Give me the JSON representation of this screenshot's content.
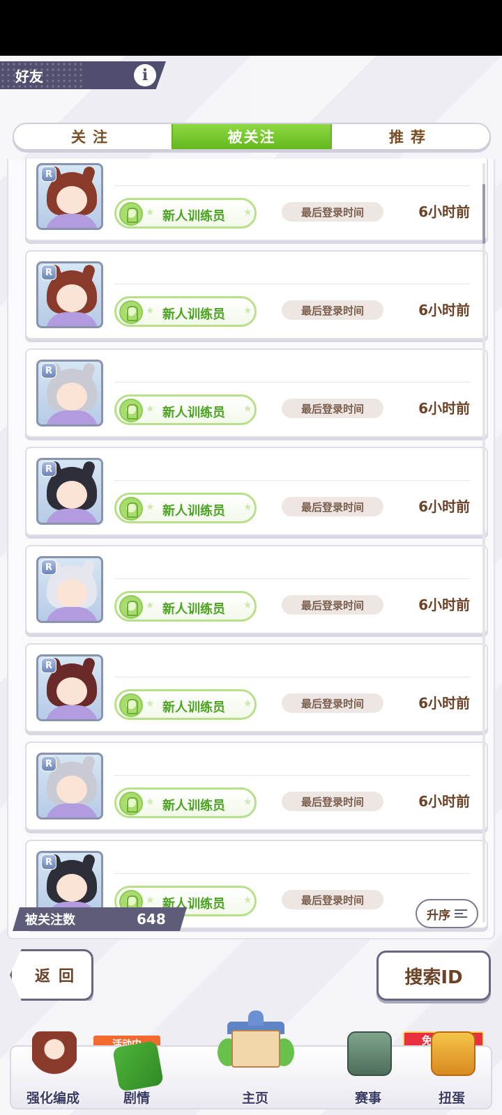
{
  "header": {
    "title": "好友"
  },
  "tabs": [
    {
      "label": "关注",
      "active": false
    },
    {
      "label": "被关注",
      "active": true
    },
    {
      "label": "推荐",
      "active": false
    }
  ],
  "list": {
    "items": [
      {
        "rarity": "R",
        "character": "brown-hair-girl",
        "title_badge": "新人训练员",
        "login_label": "最后登录时间",
        "login_time": "6小时前"
      },
      {
        "rarity": "R",
        "character": "brown-hair-girl",
        "title_badge": "新人训练员",
        "login_label": "最后登录时间",
        "login_time": "6小时前"
      },
      {
        "rarity": "R",
        "character": "silver-hair-girl",
        "title_badge": "新人训练员",
        "login_label": "最后登录时间",
        "login_time": "6小时前"
      },
      {
        "rarity": "R",
        "character": "dark-hair-girl",
        "title_badge": "新人训练员",
        "login_label": "最后登录时间",
        "login_time": "6小时前"
      },
      {
        "rarity": "R",
        "character": "white-hair-girl",
        "title_badge": "新人训练员",
        "login_label": "最后登录时间",
        "login_time": "6小时前"
      },
      {
        "rarity": "R",
        "character": "purple-eyes-girl",
        "title_badge": "新人训练员",
        "login_label": "最后登录时间",
        "login_time": "6小时前"
      },
      {
        "rarity": "R",
        "character": "silver-hair-girl",
        "title_badge": "新人训练员",
        "login_label": "最后登录时间",
        "login_time": "6小时前"
      },
      {
        "rarity": "R",
        "character": "dark-hair-girl",
        "title_badge": "新人训练员",
        "login_label": "最后登录时间",
        "login_time": ""
      }
    ]
  },
  "follower_count": {
    "label": "被关注数",
    "value": "648"
  },
  "sort": {
    "label": "升序"
  },
  "actions": {
    "back_label": "返回",
    "search_label": "搜索ID"
  },
  "bottom_nav": {
    "items": [
      {
        "label": "强化编成"
      },
      {
        "label": "剧情",
        "badge": "活动中"
      },
      {
        "label": "主页"
      },
      {
        "label": "赛事"
      },
      {
        "label": "扭蛋",
        "badge": "免费1次!"
      }
    ]
  },
  "colors": {
    "accent_green": "#62b91c",
    "text_brown": "#6b4226",
    "header_slate": "#4f4e6e"
  }
}
